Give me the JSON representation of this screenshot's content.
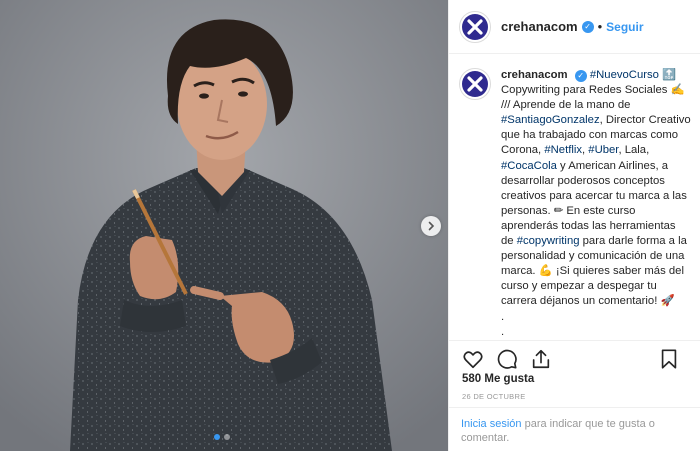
{
  "account": {
    "username": "crehanacom",
    "separator": "•",
    "follow_label": "Seguir"
  },
  "caption": {
    "username": "crehanacom",
    "segments": [
      {
        "type": "tag",
        "text": "#NuevoCurso"
      },
      {
        "type": "text",
        "text": " 🔝 Copywriting para Redes Sociales ✍ /// Aprende de la mano de "
      },
      {
        "type": "tag",
        "text": "#SantiagoGonzalez"
      },
      {
        "type": "text",
        "text": ", Director Creativo que ha trabajado con marcas como Corona, "
      },
      {
        "type": "tag",
        "text": "#Netflix"
      },
      {
        "type": "text",
        "text": ", "
      },
      {
        "type": "tag",
        "text": "#Uber"
      },
      {
        "type": "text",
        "text": ", Lala, "
      },
      {
        "type": "tag",
        "text": "#CocaCola"
      },
      {
        "type": "text",
        "text": " y American Airlines, a desarrollar poderosos conceptos creativos para acercar tu marca a las personas. ✏ En este curso aprenderás todas las herramientas de "
      },
      {
        "type": "tag",
        "text": "#copywriting"
      },
      {
        "type": "text",
        "text": " para darle forma a la personalidad y comunicación de una marca. 💪 ¡Si quieres saber más del curso y empezar a despegar tu carrera déjanos un comentario! 🚀"
      }
    ],
    "trailing_dots": [
      ".",
      "."
    ]
  },
  "stats": {
    "likes": "580 Me gusta",
    "date": "26 DE OCTUBRE"
  },
  "login_prompt": {
    "link": "Inicia sesión",
    "rest": " para indicar que te gusta o comentar."
  },
  "carousel": {
    "slide_count": 2,
    "active_index": 0
  },
  "icons": {
    "like": "heart-icon",
    "comment": "comment-icon",
    "share": "share-icon",
    "save": "bookmark-icon",
    "next": "chevron-right-icon",
    "verified": "verified-badge-icon"
  },
  "colors": {
    "link": "#3897f0",
    "hashtag": "#003569",
    "brand": "#2f2a8f",
    "photo_background": "#8a8d93"
  }
}
